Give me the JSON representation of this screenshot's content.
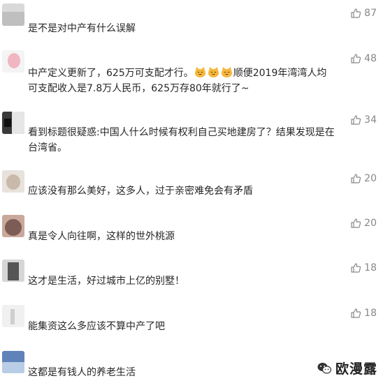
{
  "comments": [
    {
      "text": "是不是对中产有什么误解",
      "likes": "87"
    },
    {
      "text_before": "中产定义更新了，625万可支配才行。",
      "text_after": "顺便2019年湾湾人均可支配收入是7.8万人民币，625万存80年就行了~",
      "likes": "48",
      "emoji_name": "grinning-cat-emoji"
    },
    {
      "text": "看到标题很疑惑:中国人什么时候有权利自己买地建房了？结果发现是在台湾省。",
      "likes": "34"
    },
    {
      "text": "应该没有那么美好，这多人，过于亲密难免会有矛盾",
      "likes": "20"
    },
    {
      "text": "真是令人向往啊，这样的世外桃源",
      "likes": "20"
    },
    {
      "text": "这才是生活，好过城市上亿的别墅！",
      "likes": "18"
    },
    {
      "text": "能集资这么多应该不算中产了吧",
      "likes": "18"
    },
    {
      "text": "这都是有钱人的养老生活",
      "likes": ""
    }
  ],
  "watermark": {
    "text": "欧漫露",
    "icon": "wechat-icon"
  },
  "colors": {
    "text": "#262626",
    "like": "#888888",
    "accent": "#576b95"
  }
}
